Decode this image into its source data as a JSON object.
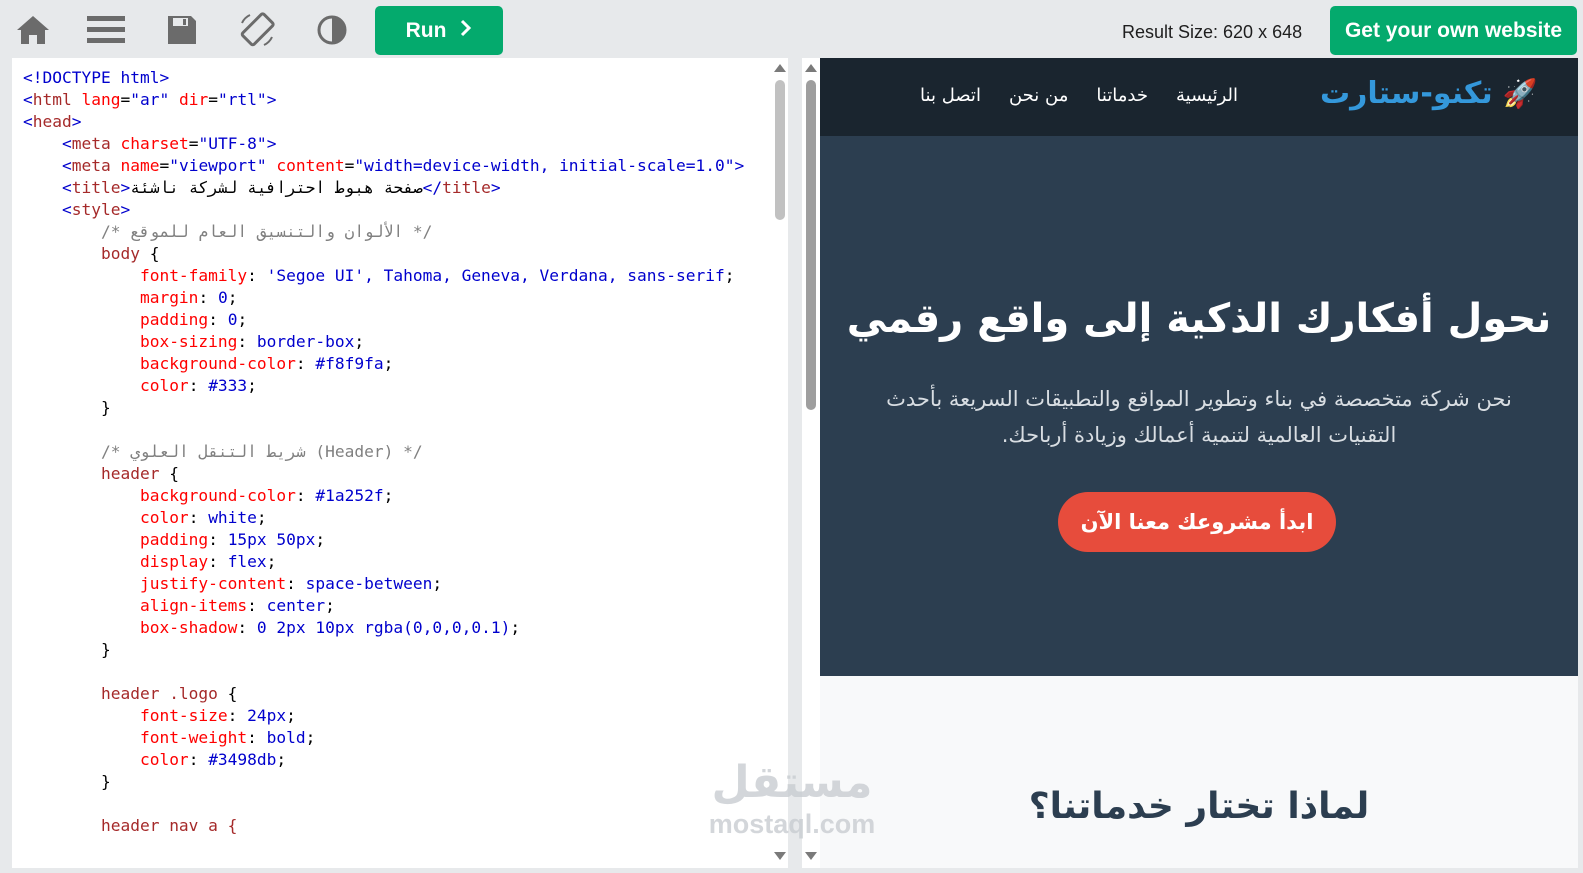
{
  "toolbar": {
    "home_icon": "home-icon",
    "menu_icon": "menu-icon",
    "save_icon": "save-icon",
    "rotate_icon": "rotate-icon",
    "theme_icon": "contrast-icon",
    "run_label": "Run",
    "result_size": "Result Size: 620 x 648",
    "get_website_label": "Get your own website"
  },
  "editor": {
    "lines": {
      "l1": "<!DOCTYPE html>",
      "html_tag": "html",
      "lang_attr": "lang",
      "lang_val": "\"ar\"",
      "dir_attr": "dir",
      "dir_val": "\"rtl\"",
      "head_tag": "head",
      "meta_tag": "meta",
      "charset_attr": "charset",
      "charset_val": "\"UTF-8\"",
      "name_attr": "name",
      "name_val": "\"viewport\"",
      "content_attr": "content",
      "content_val": "\"width=device-width, initial-scale=1.0\"",
      "title_tag": "title",
      "title_text": "صفحة هبوط احترافية لشركة ناشئة",
      "style_tag": "style",
      "comment1": "/* الألوان والتنسيق العام للموقع */",
      "body_sel": "body",
      "font_family_prop": "font-family",
      "font_family_val": "'Segoe UI', Tahoma, Geneva, Verdana, sans-serif",
      "margin_prop": "margin",
      "margin_val": "0",
      "padding_prop": "padding",
      "padding_val": "0",
      "box_sizing_prop": "box-sizing",
      "box_sizing_val": "border-box",
      "bg_prop": "background-color",
      "bg_val": "#f8f9fa",
      "color_prop": "color",
      "color_val": "#333",
      "comment2": "/* شريط التنقل العلوي (Header) */",
      "header_sel": "header",
      "header_bg_val": "#1a252f",
      "header_color_val": "white",
      "header_padding_val": "15px 50px",
      "display_prop": "display",
      "display_val": "flex",
      "jc_prop": "justify-content",
      "jc_val": "space-between",
      "ai_prop": "align-items",
      "ai_val": "center",
      "bs_prop": "box-shadow",
      "bs_val": "0 2px 10px rgba(0,0,0,0.1)",
      "logo_sel": "header .logo",
      "fs_prop": "font-size",
      "fs_val": "24px",
      "fw_prop": "font-weight",
      "fw_val": "bold",
      "logo_color_val": "#3498db",
      "next_sel": "header nav a {"
    }
  },
  "preview": {
    "logo_text": "تكنو-ستارت",
    "logo_icon": "rocket-icon",
    "nav": [
      "الرئيسية",
      "خدماتنا",
      "من نحن",
      "اتصل بنا"
    ],
    "hero_title": "نحول أفكارك الذكية إلى واقع رقمي",
    "hero_subtitle": "نحن شركة متخصصة في بناء وتطوير المواقع والتطبيقات السريعة بأحدث التقنيات العالمية لتنمية أعمالك وزيادة أرباحك.",
    "cta_label": "ابدأ مشروعك معنا الآن",
    "why_title": "لماذا تختار خدماتنا؟"
  },
  "watermark": {
    "arabic": "مستقل",
    "latin": "mostaql.com"
  },
  "colors": {
    "toolbar_bg": "#e7e9eb",
    "accent_green": "#04aa6d",
    "header_dark": "#1a252f",
    "hero_bg": "#2c3e50",
    "logo_blue": "#3498db",
    "cta_red": "#e74c3c"
  }
}
